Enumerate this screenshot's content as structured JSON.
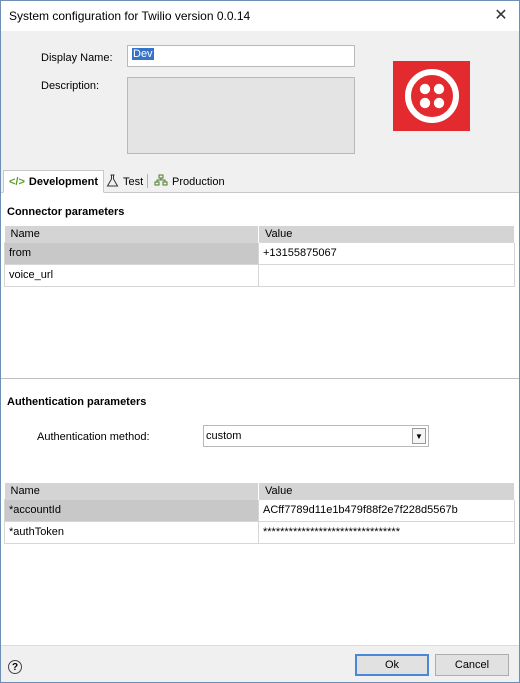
{
  "window": {
    "title": "System configuration for Twilio version 0.0.14",
    "close_label": "✕"
  },
  "form": {
    "display_name_label": "Display Name:",
    "display_name_value": "Dev",
    "description_label": "Description:"
  },
  "logo": {
    "icon": "twilio-logo-icon",
    "color": "#e32a2e"
  },
  "tabs": [
    {
      "label": "Development",
      "icon": "code-icon",
      "active": true
    },
    {
      "label": "Test",
      "icon": "flask-icon",
      "active": false
    },
    {
      "label": "Production",
      "icon": "network-icon",
      "active": false
    }
  ],
  "connector": {
    "title": "Connector parameters",
    "columns": [
      "Name",
      "Value"
    ],
    "rows": [
      {
        "name": "from",
        "value": "+13155875067"
      },
      {
        "name": "voice_url",
        "value": ""
      }
    ]
  },
  "auth": {
    "title": "Authentication parameters",
    "method_label": "Authentication method:",
    "method_value": "custom",
    "columns": [
      "Name",
      "Value"
    ],
    "rows": [
      {
        "name": "*accountId",
        "value": "ACff7789d11e1b479f88f2e7f228d5567b"
      },
      {
        "name": "*authToken",
        "value": "********************************"
      }
    ]
  },
  "footer": {
    "help_label": "?",
    "ok_label": "Ok",
    "cancel_label": "Cancel"
  }
}
